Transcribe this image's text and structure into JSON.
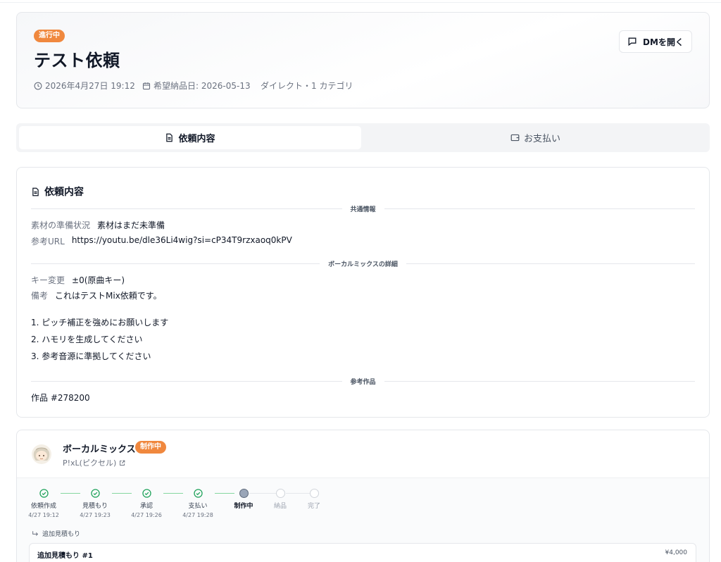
{
  "header": {
    "status_badge": "進行中",
    "title": "テスト依頼",
    "created_at": "2026年4月27日 19:12",
    "due_date": "希望納品日: 2026-05-13",
    "category": "ダイレクト・1 カテゴリ",
    "dm_button": "DMを開く"
  },
  "tabs": [
    {
      "label": "依頼内容",
      "icon": "document-icon",
      "active": true
    },
    {
      "label": "お支払い",
      "icon": "wallet-icon",
      "active": false
    }
  ],
  "detail": {
    "title": "依頼内容",
    "common_section": "共通情報",
    "material_label": "素材の準備状況",
    "material_value": "素材はまだ未準備",
    "url_label": "参考URL",
    "url_value": "https://youtu.be/dle36Li4wig?si=cP34T9rzxaoq0kPV",
    "mix_section": "ボーカルミックスの詳細",
    "key_label": "キー変更",
    "key_value": "±0(原曲キー)",
    "note_label": "備考",
    "note_value": "これはテストMix依頼です。",
    "note_lines": [
      "1. ピッチ補正を強めにお願いします",
      "2. ハモリを生成してください",
      "3. 参考音源に準拠してください"
    ],
    "works_section": "参考作品",
    "work_item": "作品 #278200"
  },
  "order": {
    "title": "ボーカルミックス",
    "status_badge": "制作中",
    "creator": "P!xL(ピクセル)",
    "steps": [
      {
        "name": "依頼作成",
        "time": "4/27 19:12",
        "state": "done"
      },
      {
        "name": "見積もり",
        "time": "4/27 19:23",
        "state": "done"
      },
      {
        "name": "承認",
        "time": "4/27 19:26",
        "state": "done"
      },
      {
        "name": "支払い",
        "time": "4/27 19:28",
        "state": "done"
      },
      {
        "name": "制作中",
        "time": "",
        "state": "current"
      },
      {
        "name": "納品",
        "time": "",
        "state": "pending"
      },
      {
        "name": "完了",
        "time": "",
        "state": "pending"
      }
    ],
    "additional_label": "追加見積もり",
    "additional_item_name": "追加見積もり #1",
    "additional_item_amount": "¥4,000"
  },
  "colors": {
    "accent_orange": "#f0883e",
    "done_green": "#22a45d",
    "current_grey": "#9aa6b8"
  }
}
